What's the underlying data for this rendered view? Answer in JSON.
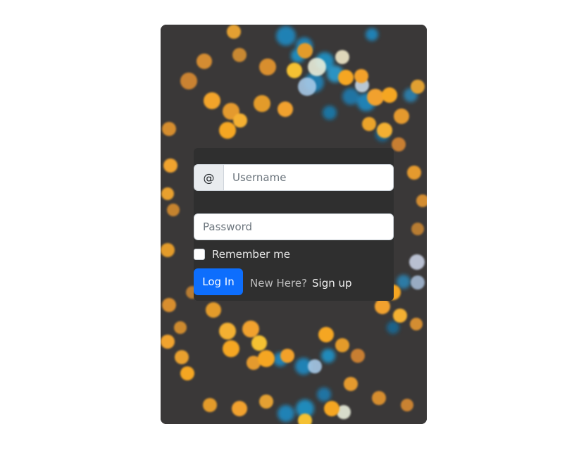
{
  "login": {
    "username_addon": "@",
    "username_placeholder": "Username",
    "password_placeholder": "Password",
    "remember_label": "Remember me",
    "login_label": "Log In",
    "new_here_text": "New Here?",
    "signup_label": "Sign up"
  },
  "colors": {
    "card_background": "#3a3838",
    "panel_background": "#2f2f2f",
    "button_primary": "#0d6efd",
    "bokeh_orange": "#f5a623",
    "bokeh_blue": "#1c8fc9"
  }
}
